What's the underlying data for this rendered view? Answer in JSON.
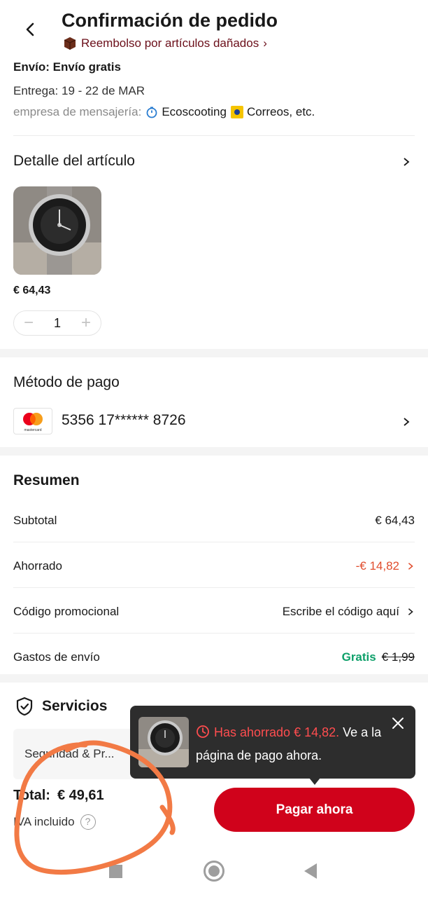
{
  "header": {
    "title": "Confirmación de pedido",
    "refund_link": "Reembolso por artículos dañados",
    "refund_chevron": "›"
  },
  "shipping": {
    "method": "Envío: Envío gratis",
    "delivery": "Entrega: 19 - 22 de MAR",
    "courier_label": "empresa de mensajería:",
    "courier_1": "Ecoscooting",
    "courier_2": "Correos, etc."
  },
  "item_detail": {
    "title": "Detalle del artículo",
    "price": "€ 64,43",
    "quantity": "1",
    "minus": "−",
    "plus": "+"
  },
  "payment": {
    "title": "Método de pago",
    "card_number": "5356 17****** 8726",
    "card_brand": "mastercard"
  },
  "summary": {
    "title": "Resumen",
    "rows": [
      {
        "label": "Subtotal",
        "value": "€ 64,43"
      },
      {
        "label": "Ahorrado",
        "value": "-€ 14,82"
      },
      {
        "label": "Código promocional",
        "value": "Escribe el código aquí"
      },
      {
        "label": "Gastos de envío",
        "value": "Gratis",
        "old_value": "€ 1,99"
      }
    ]
  },
  "services": {
    "title": "Servicios",
    "item": "Seguridad & Pr..."
  },
  "toast": {
    "highlight": "Has ahorrado € 14,82.",
    "message": "Ve a la página de pago ahora."
  },
  "footer": {
    "total_label": "Total:",
    "total_value": "€ 49,61",
    "vat": "IVA incluido",
    "help": "?",
    "pay_button": "Pagar ahora"
  },
  "colors": {
    "brand_red": "#d0021b",
    "saved_red": "#e04d2d",
    "free_green": "#0ea06a",
    "refund_text": "#6b0f1a",
    "toast_bg": "#2d2d2d",
    "annotation_orange": "#f27a45"
  },
  "icons": [
    "back-arrow-icon",
    "box-icon",
    "stopwatch-icon",
    "correos-icon",
    "chevron-right-icon",
    "mastercard-icon",
    "shield-check-icon",
    "clock-icon",
    "close-icon",
    "help-icon"
  ]
}
